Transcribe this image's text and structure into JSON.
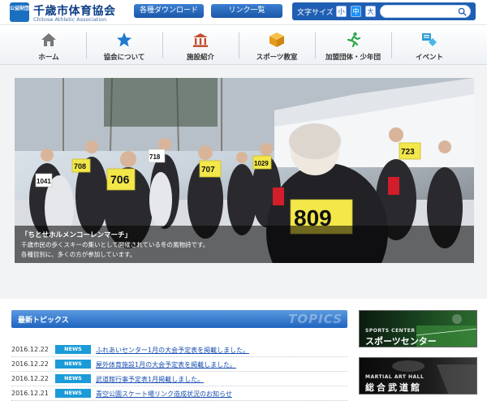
{
  "site": {
    "logo_mark": "公益財団",
    "title": "千歳市体育協会",
    "subtitle": "Chitose Athletic Association"
  },
  "header": {
    "download_label": "各種ダウンロード",
    "links_label": "リンク一覧",
    "font_size_label": "文字サイズ",
    "font_small": "小",
    "font_mid": "中",
    "font_large": "大",
    "search_placeholder": ""
  },
  "nav": {
    "items": [
      {
        "label": "ホーム",
        "icon": "home-icon"
      },
      {
        "label": "協会について",
        "icon": "star-icon"
      },
      {
        "label": "施設紹介",
        "icon": "building-icon"
      },
      {
        "label": "スポーツ教室",
        "icon": "box-icon"
      },
      {
        "label": "加盟団体・少年団",
        "icon": "runner-icon"
      },
      {
        "label": "イベント",
        "icon": "event-icon"
      }
    ]
  },
  "hero": {
    "caption_title": "「ちとせホルメンコーレンマーチ」",
    "caption_line1": "千歳市民の歩くスキーの集いとして開催されている冬の風物詩です。",
    "caption_line2": "各種目別に、多くの方が参加しています。",
    "bibs": [
      "706",
      "707",
      "809",
      "723",
      "708",
      "1029",
      "1041",
      "718"
    ]
  },
  "topics": {
    "title": "最新トピックス",
    "title_en": "TOPICS",
    "items": [
      {
        "date": "2016.12.22",
        "badge": "NEWS",
        "title": "ふれあいセンター1月の大会予定表を掲載しました。"
      },
      {
        "date": "2016.12.22",
        "badge": "NEWS",
        "title": "屋外体育施設1月の大会予定表を掲載しました。"
      },
      {
        "date": "2016.12.22",
        "badge": "NEWS",
        "title": "武道館行事予定表1月掲載しました。"
      },
      {
        "date": "2016.12.21",
        "badge": "NEWS",
        "title": "青空公園スケート場リンク造成状況のお知らせ"
      }
    ]
  },
  "banners": {
    "sports_small": "SPORTS CENTER",
    "sports_big": "スポーツセンター",
    "budo_small": "MARTIAL ART HALL",
    "budo_big": "総合武道館"
  },
  "colors": {
    "brand_blue": "#1f5fb3",
    "badge_blue": "#1b9bd8",
    "link_blue": "#1a4fb0"
  }
}
